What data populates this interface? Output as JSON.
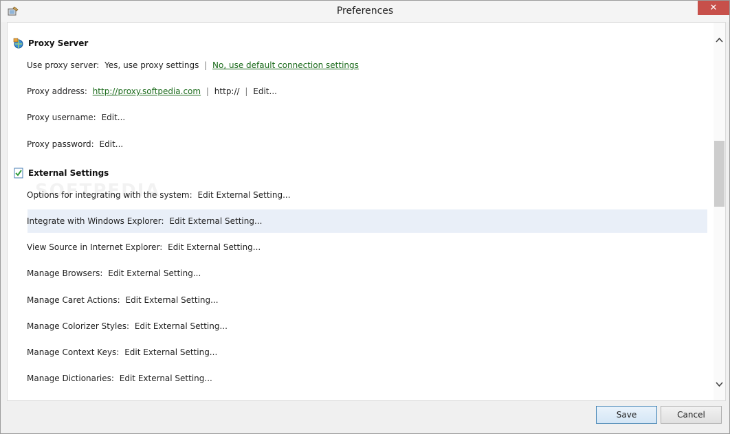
{
  "window": {
    "title": "Preferences",
    "close_glyph": "✕",
    "icon": "preferences-app-icon"
  },
  "proxy": {
    "title": "Proxy Server",
    "icon": "globe-settings-icon",
    "use_proxy_label": "Use proxy server:",
    "use_proxy_option1": "Yes, use proxy settings",
    "separator": "|",
    "use_proxy_option2": "No, use default connection settings",
    "address_label": "Proxy address:",
    "address_value": "http://proxy.softpedia.com",
    "address_alt": "http://",
    "edit": "Edit...",
    "username_label": "Proxy username:",
    "password_label": "Proxy password:"
  },
  "external": {
    "title": "External Settings",
    "icon": "checklist-icon",
    "edit_label": "Edit External Setting...",
    "items": [
      "Options for integrating with the system:",
      "Integrate with Windows Explorer:",
      "View Source in Internet Explorer:",
      "Manage Browsers:",
      "Manage Caret Actions:",
      "Manage Colorizer Styles:",
      "Manage Context Keys:",
      "Manage Dictionaries:"
    ]
  },
  "watermark": "SOFTPEDIA",
  "buttons": {
    "save": "Save",
    "cancel": "Cancel"
  },
  "colors": {
    "link": "#1a6a1a",
    "highlight": "#e9eff8",
    "close": "#c7504a"
  }
}
